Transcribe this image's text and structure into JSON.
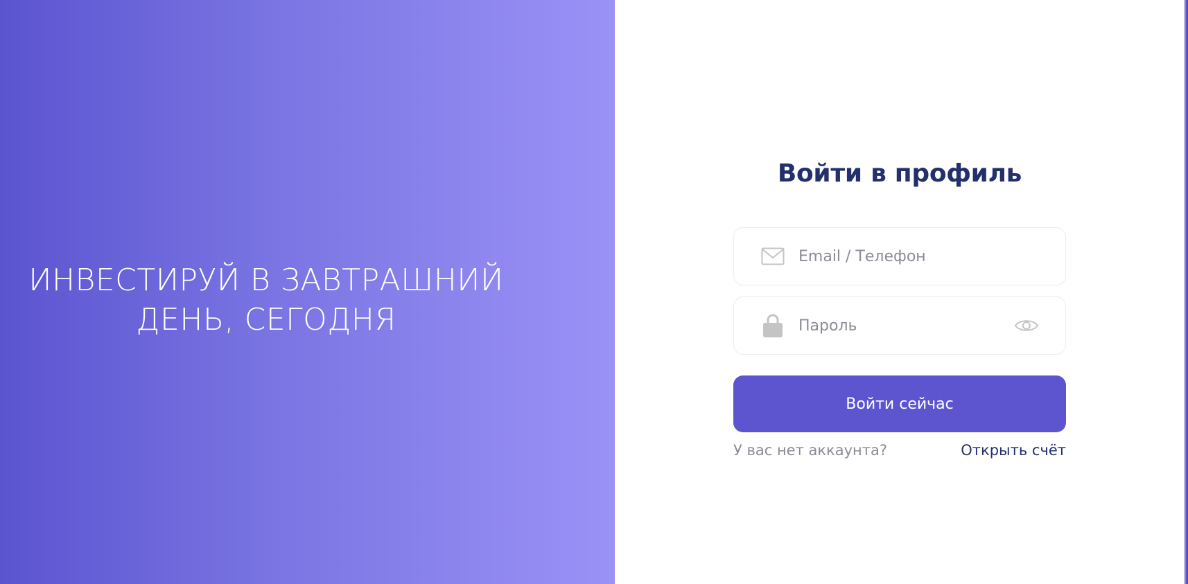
{
  "hero": {
    "headline_line1": "ИНВЕСТИРУЙ В ЗАВТРАШНИЙ",
    "headline_line2": "ДЕНЬ, СЕГОДНЯ"
  },
  "login": {
    "title": "Войти в профиль",
    "email_field": {
      "placeholder": "Email / Телефон",
      "value": "",
      "icon": "envelope-icon"
    },
    "password_field": {
      "placeholder": "Пароль",
      "value": "",
      "icon": "lock-icon",
      "toggle_icon": "eye-icon"
    },
    "submit_label": "Войти сейчас",
    "signup_question": "У вас нет аккаунта?",
    "signup_link": "Открыть счёт"
  },
  "colors": {
    "hero_gradient_start": "#5b54d0",
    "hero_gradient_end": "#9a92f6",
    "primary_button": "#5d55d0",
    "title_text": "#23306b",
    "muted_text": "#8b8b95",
    "icon_gray": "#c4c4c4",
    "field_border": "#ececf1"
  }
}
